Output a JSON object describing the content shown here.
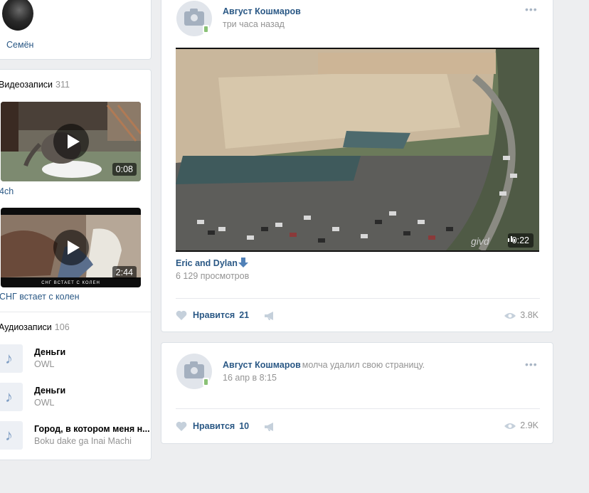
{
  "left": {
    "friend": {
      "name": "Семён"
    },
    "videos": {
      "title": "Видеозаписи",
      "count": "311",
      "items": [
        {
          "duration": "0:08",
          "label": "4ch"
        },
        {
          "duration": "2:44",
          "label": "СНГ встает с колен",
          "caption": "СНГ ВСТАЕТ С КОЛЕН"
        }
      ]
    },
    "audio": {
      "title": "Аудиозаписи",
      "count": "106",
      "items": [
        {
          "title": "Деньги",
          "artist": "OWL"
        },
        {
          "title": "Деньги",
          "artist": "OWL"
        },
        {
          "title": "Город, в котором меня н...",
          "artist": "Boku dake ga Inai Machi"
        }
      ]
    }
  },
  "posts": [
    {
      "author": "Август Кошмаров",
      "time": "три часа назад",
      "more": "•••",
      "video": {
        "duration": "0:22",
        "title": "Eric and Dylan",
        "views": "6 129 просмотров",
        "watermark": "givd"
      },
      "likes_label": "Нравится",
      "likes_count": "21",
      "views": "3.8K"
    },
    {
      "author": "Август Кошмаров",
      "action": "молча удалил свою страницу.",
      "time": "16 апр в 8:15",
      "more": "•••",
      "likes_label": "Нравится",
      "likes_count": "10",
      "views": "2.9K"
    }
  ],
  "colors": {
    "link": "#2a5885",
    "muted": "#939393",
    "page_bg": "#edeef0",
    "accent": "#5181b8"
  }
}
